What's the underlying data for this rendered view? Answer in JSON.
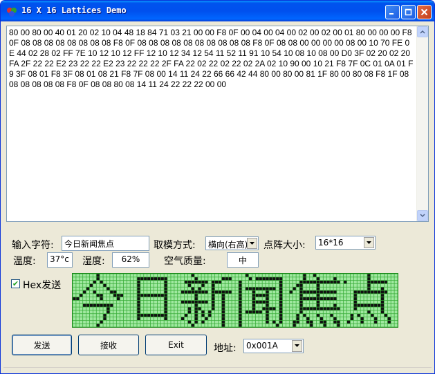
{
  "window": {
    "title": "16 X 16 Lattices Demo"
  },
  "colors": {
    "lattice_on": "#111111",
    "lattice_off": "#a0e8a0",
    "lattice_grid": "#3aae3a"
  },
  "hex_output": "80 00 80 00 40 01 20 02 10 04 48 18 84 71 03 21 00 00 F8 0F 00 04 00 04 00 02 00 02 00 01 80 00 00 00 F8 0F 08 08 08 08 08 08 08 08 F8 0F 08 08 08 08 08 08 08 08 08 08 F8 0F 08 08 00 00 00 00 08 00 10 70 FE 0E 44 02 28 02 FF 7E 10 12 10 12 FF 12 10 12 34 12 54 11 52 11 91 10 54 10 08 10 08 00 D0 3F 02 20 02 20 FA 2F 22 22 E2 23 22 22 E2 23 22 22 22 2F FA 22 02 22 02 22 02 2A 02 10 90 00 10 21 F8 7F 0C 01 0A 01 F9 3F 08 01 F8 3F 08 01 08 21 F8 7F 08 00 14 11 24 22 66 66 42 44 80 00 80 00 81 1F 80 00 80 08 F8 1F 08 08 08 08 08 08 F8 0F 08 08 80 08 14 11 24 22 22 22 00 00",
  "labels": {
    "input_char": "输入字符:",
    "mode": "取模方式:",
    "size": "点阵大小:",
    "temperature": "温度:",
    "humidity": "湿度:",
    "air_quality": "空气质量:",
    "hex_send": "Hex发送",
    "address": "地址:"
  },
  "fields": {
    "input_char": "今日新闻焦点",
    "mode": "横向(右高)",
    "size": "16*16",
    "temperature": "37°c",
    "humidity": "62%",
    "air_quality": "中",
    "address": "0x001A"
  },
  "checkbox": {
    "hex_send_checked": true,
    "mark": "✔"
  },
  "buttons": {
    "send": "发送",
    "receive": "接收",
    "exit": "Exit"
  },
  "lattice": {
    "rows": 16,
    "cols": 96,
    "characters": "今日新闻焦点"
  }
}
